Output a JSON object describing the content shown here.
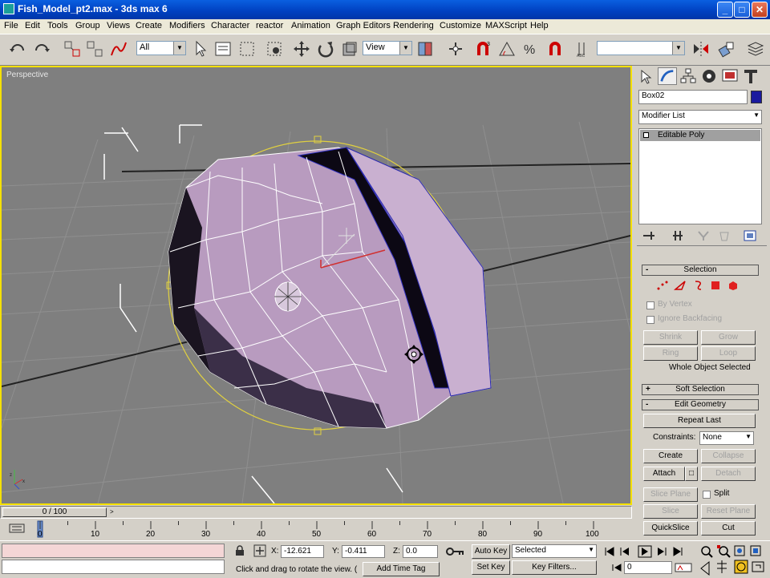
{
  "window": {
    "title": "Fish_Model_pt2.max - 3ds max 6",
    "min": "_",
    "max": "□",
    "close": "✕"
  },
  "menu": [
    "File",
    "Edit",
    "Tools",
    "Group",
    "Views",
    "Create",
    "Modifiers",
    "Character",
    "reactor",
    "Animation",
    "Graph Editors",
    "Rendering",
    "Customize",
    "MAXScript",
    "Help"
  ],
  "toolbar": {
    "filter_value": "All",
    "coord_value": "View",
    "named_sel_value": ""
  },
  "viewport": {
    "label": "Perspective"
  },
  "command_panel": {
    "object_name": "Box02",
    "object_color": "#1a1a9e",
    "modifier_list": "Modifier List",
    "stack_item": "Editable Poly",
    "selection": {
      "title": "Selection",
      "by_vertex": "By Vertex",
      "ignore_backfacing": "Ignore Backfacing",
      "shrink": "Shrink",
      "grow": "Grow",
      "ring": "Ring",
      "loop": "Loop",
      "status": "Whole Object Selected"
    },
    "soft_selection": {
      "title": "Soft Selection"
    },
    "edit_geometry": {
      "title": "Edit Geometry",
      "repeat_last": "Repeat Last",
      "constraints_label": "Constraints:",
      "constraints_value": "None",
      "create": "Create",
      "collapse": "Collapse",
      "attach": "Attach",
      "detach": "Detach",
      "slice_plane": "Slice Plane",
      "split": "Split",
      "slice": "Slice",
      "reset_plane": "Reset Plane",
      "quickslice": "QuickSlice",
      "cut": "Cut"
    }
  },
  "time": {
    "slider": "0 / 100",
    "ticks": [
      "0",
      "10",
      "20",
      "30",
      "40",
      "50",
      "60",
      "70",
      "80",
      "90",
      "100"
    ]
  },
  "status": {
    "x_label": "X:",
    "x_value": "-12.621",
    "y_label": "Y:",
    "y_value": "-0.411",
    "z_label": "Z:",
    "z_value": "0.0",
    "prompt": "Click and drag to rotate the view. (",
    "add_time_tag": "Add Time Tag",
    "auto_key": "Auto Key",
    "set_key": "Set Key",
    "key_mode_value": "Selected",
    "key_filters": "Key Filters...",
    "frame_value": "0"
  }
}
